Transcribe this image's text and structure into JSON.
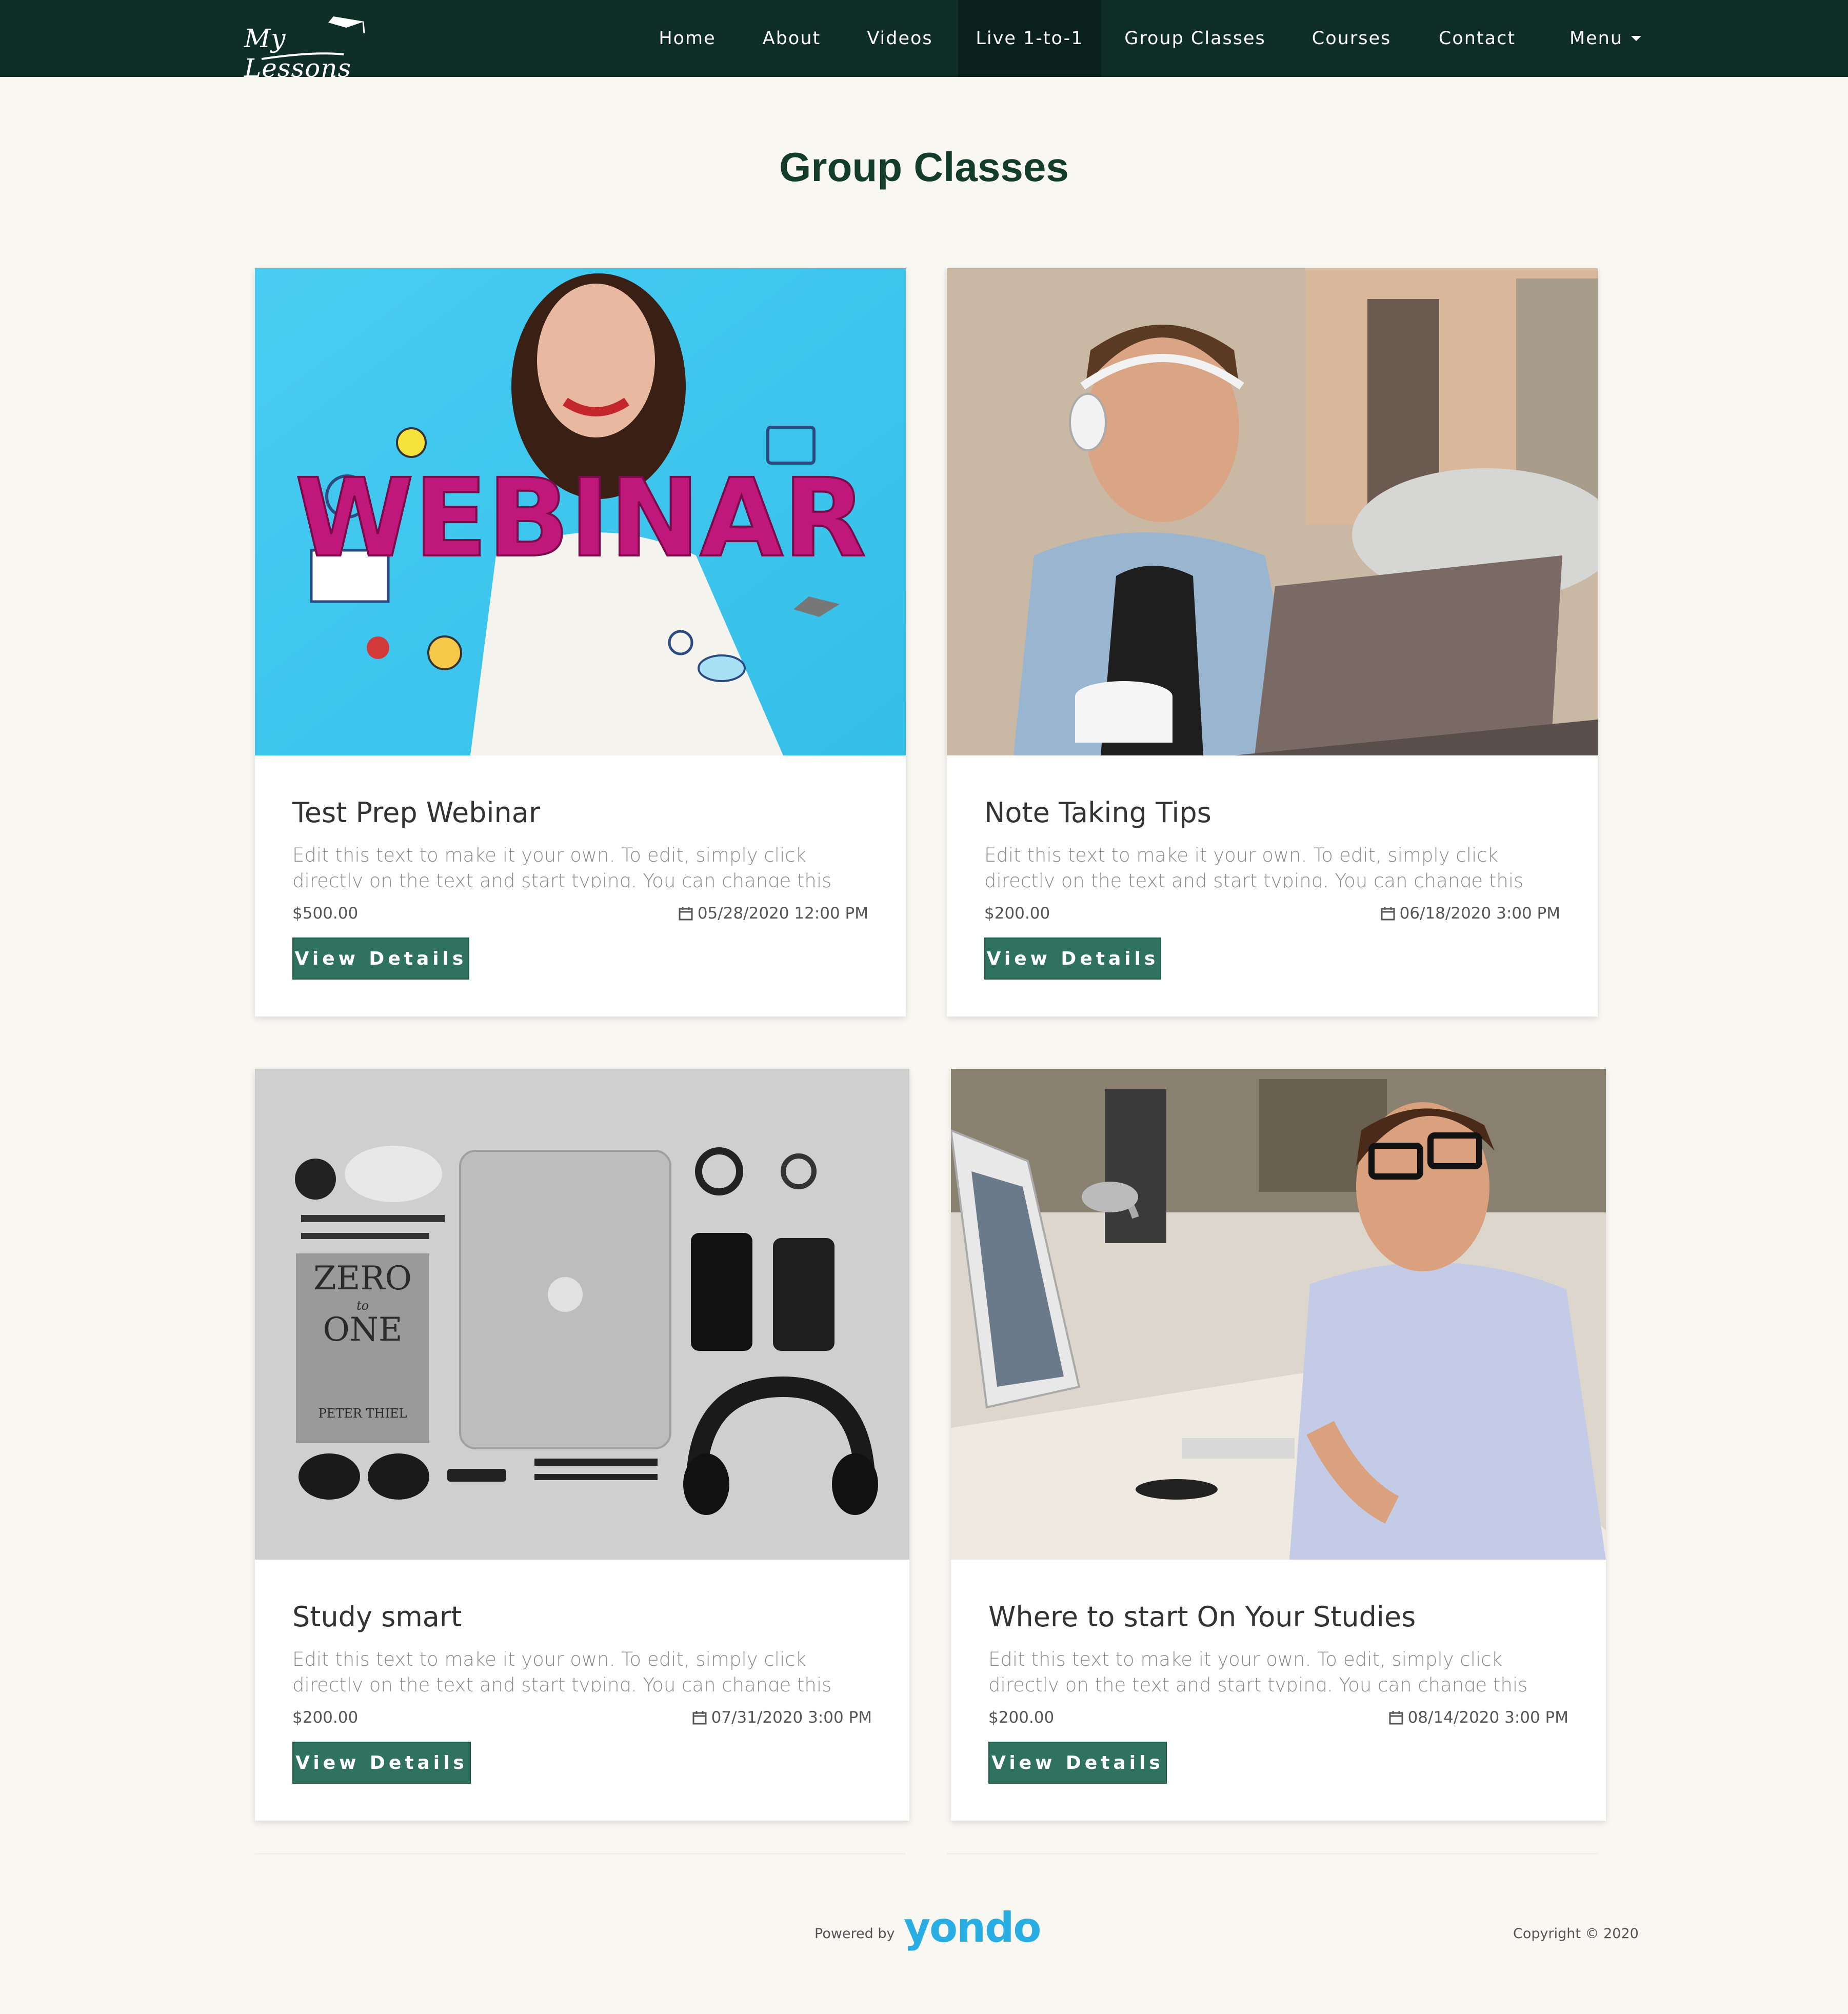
{
  "nav": {
    "logo_text": "My Lessons",
    "items": [
      "Home",
      "About",
      "Videos",
      "Live 1-to-1",
      "Group Classes",
      "Courses",
      "Contact",
      "Menu"
    ],
    "active": "Live 1-to-1"
  },
  "page": {
    "title": "Group Classes"
  },
  "cards": [
    {
      "title": "Test Prep Webinar",
      "description": "Edit this text to make it your own. To edit, simply click directly on the text and start typing. You can change this text by going to your Yond...",
      "price": "$500.00",
      "date": "05/28/2020 12:00 PM",
      "button": "View Details",
      "image_overlay_text": "WEBINAR"
    },
    {
      "title": "Note Taking Tips",
      "description": "Edit this text to make it your own. To edit, simply click directly on the text and start typing. You can change this text by going to your Yond...",
      "price": "$200.00",
      "date": "06/18/2020 3:00 PM",
      "button": "View Details"
    },
    {
      "title": "Study smart",
      "description": "Edit this text to make it your own. To edit, simply click directly on the text and start typing. You can change this text by going to your Yond...",
      "price": "$200.00",
      "date": "07/31/2020 3:00 PM",
      "button": "View Details",
      "image_book_text": [
        "ZERO",
        "to",
        "ONE",
        "PETER THIEL"
      ]
    },
    {
      "title": "Where to start On Your Studies",
      "description": "Edit this text to make it your own. To edit, simply click directly on the text and start typing. You can change this text by going to your Yond...",
      "price": "$200.00",
      "date": "08/14/2020 3:00 PM",
      "button": "View Details"
    }
  ],
  "footer": {
    "powered_by": "Powered by",
    "brand": "yondo",
    "copyright": "Copyright © 2020"
  },
  "colors": {
    "nav_bg": "#0f2e25",
    "page_bg": "#f9f7f2",
    "title": "#143c2c",
    "button_bg": "#2f735f",
    "brand": "#29aee3"
  }
}
